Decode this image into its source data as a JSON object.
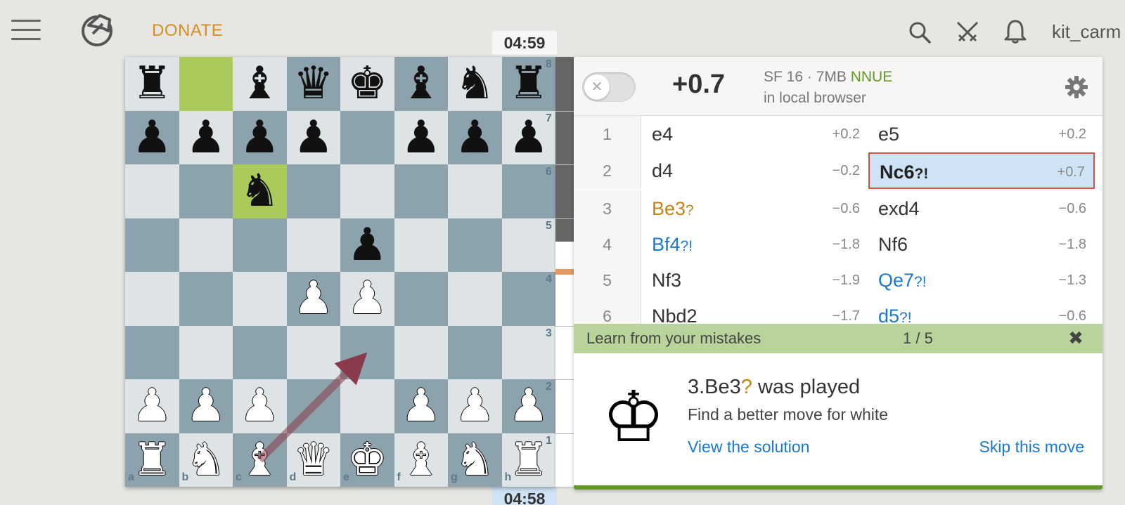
{
  "header": {
    "donate_label": "DONATE",
    "username": "kit_carm"
  },
  "clocks": {
    "top": "04:59",
    "bottom": "04:58"
  },
  "eval_gauge": {
    "white_fraction": 0.57
  },
  "board": {
    "ranks": [
      "8",
      "7",
      "6",
      "5",
      "4",
      "3",
      "2",
      "1"
    ],
    "files": [
      "a",
      "b",
      "c",
      "d",
      "e",
      "f",
      "g",
      "h"
    ],
    "highlights": [
      "b8",
      "c6"
    ],
    "arrow": {
      "from": "c1",
      "to": "e3",
      "color": "#8a3a4a"
    },
    "pieces": [
      {
        "sq": "a8",
        "color": "b",
        "type": "rook",
        "glyph": "♜"
      },
      {
        "sq": "c8",
        "color": "b",
        "type": "bishop",
        "glyph": "♝"
      },
      {
        "sq": "d8",
        "color": "b",
        "type": "queen",
        "glyph": "♛"
      },
      {
        "sq": "e8",
        "color": "b",
        "type": "king",
        "glyph": "♚"
      },
      {
        "sq": "f8",
        "color": "b",
        "type": "bishop",
        "glyph": "♝"
      },
      {
        "sq": "g8",
        "color": "b",
        "type": "knight",
        "glyph": "♞"
      },
      {
        "sq": "h8",
        "color": "b",
        "type": "rook",
        "glyph": "♜"
      },
      {
        "sq": "a7",
        "color": "b",
        "type": "pawn",
        "glyph": "♟"
      },
      {
        "sq": "b7",
        "color": "b",
        "type": "pawn",
        "glyph": "♟"
      },
      {
        "sq": "c7",
        "color": "b",
        "type": "pawn",
        "glyph": "♟"
      },
      {
        "sq": "d7",
        "color": "b",
        "type": "pawn",
        "glyph": "♟"
      },
      {
        "sq": "f7",
        "color": "b",
        "type": "pawn",
        "glyph": "♟"
      },
      {
        "sq": "g7",
        "color": "b",
        "type": "pawn",
        "glyph": "♟"
      },
      {
        "sq": "h7",
        "color": "b",
        "type": "pawn",
        "glyph": "♟"
      },
      {
        "sq": "c6",
        "color": "b",
        "type": "knight",
        "glyph": "♞"
      },
      {
        "sq": "e5",
        "color": "b",
        "type": "pawn",
        "glyph": "♟"
      },
      {
        "sq": "d4",
        "color": "w",
        "type": "pawn",
        "glyph": "♟"
      },
      {
        "sq": "e4",
        "color": "w",
        "type": "pawn",
        "glyph": "♟"
      },
      {
        "sq": "a2",
        "color": "w",
        "type": "pawn",
        "glyph": "♟"
      },
      {
        "sq": "b2",
        "color": "w",
        "type": "pawn",
        "glyph": "♟"
      },
      {
        "sq": "c2",
        "color": "w",
        "type": "pawn",
        "glyph": "♟"
      },
      {
        "sq": "f2",
        "color": "w",
        "type": "pawn",
        "glyph": "♟"
      },
      {
        "sq": "g2",
        "color": "w",
        "type": "pawn",
        "glyph": "♟"
      },
      {
        "sq": "h2",
        "color": "w",
        "type": "pawn",
        "glyph": "♟"
      },
      {
        "sq": "a1",
        "color": "w",
        "type": "rook",
        "glyph": "♜"
      },
      {
        "sq": "b1",
        "color": "w",
        "type": "knight",
        "glyph": "♞"
      },
      {
        "sq": "c1",
        "color": "w",
        "type": "bishop",
        "glyph": "♝"
      },
      {
        "sq": "d1",
        "color": "w",
        "type": "queen",
        "glyph": "♛"
      },
      {
        "sq": "e1",
        "color": "w",
        "type": "king",
        "glyph": "♚"
      },
      {
        "sq": "f1",
        "color": "w",
        "type": "bishop",
        "glyph": "♝"
      },
      {
        "sq": "g1",
        "color": "w",
        "type": "knight",
        "glyph": "♞"
      },
      {
        "sq": "h1",
        "color": "w",
        "type": "rook",
        "glyph": "♜"
      }
    ]
  },
  "engine": {
    "eval": "+0.7",
    "name": "SF 16 · 7MB",
    "nnue": "NNUE",
    "location": "in local browser"
  },
  "moves": [
    {
      "num": "1",
      "white": {
        "san": "e4",
        "glyph": "",
        "eval": "+0.2",
        "cls": ""
      },
      "black": {
        "san": "e5",
        "glyph": "",
        "eval": "+0.2",
        "cls": ""
      }
    },
    {
      "num": "2",
      "white": {
        "san": "d4",
        "glyph": "",
        "eval": "−0.2",
        "cls": ""
      },
      "black": {
        "san": "Nc6",
        "glyph": "?!",
        "eval": "+0.7",
        "cls": "active"
      }
    },
    {
      "num": "3",
      "white": {
        "san": "Be3",
        "glyph": "?",
        "eval": "−0.6",
        "cls": "mistake"
      },
      "black": {
        "san": "exd4",
        "glyph": "",
        "eval": "−0.6",
        "cls": ""
      }
    },
    {
      "num": "4",
      "white": {
        "san": "Bf4",
        "glyph": "?!",
        "eval": "−1.8",
        "cls": "inacc"
      },
      "black": {
        "san": "Nf6",
        "glyph": "",
        "eval": "−1.8",
        "cls": ""
      }
    },
    {
      "num": "5",
      "white": {
        "san": "Nf3",
        "glyph": "",
        "eval": "−1.9",
        "cls": ""
      },
      "black": {
        "san": "Qe7",
        "glyph": "?!",
        "eval": "−1.3",
        "cls": "inacc"
      }
    },
    {
      "num": "6",
      "white": {
        "san": "Nbd2",
        "glyph": "",
        "eval": "−1.7",
        "cls": ""
      },
      "black": {
        "san": "d5",
        "glyph": "?!",
        "eval": "−0.6",
        "cls": "inacc"
      }
    }
  ],
  "learn": {
    "title": "Learn from your mistakes",
    "count": "1 / 5",
    "close_glyph": "✖",
    "played_move": "3.Be3",
    "played_glyph": "?",
    "played_suffix": " was played",
    "prompt": "Find a better move for white",
    "view_solution": "View the solution",
    "skip_move": "Skip this move",
    "king_glyph": "♔"
  }
}
